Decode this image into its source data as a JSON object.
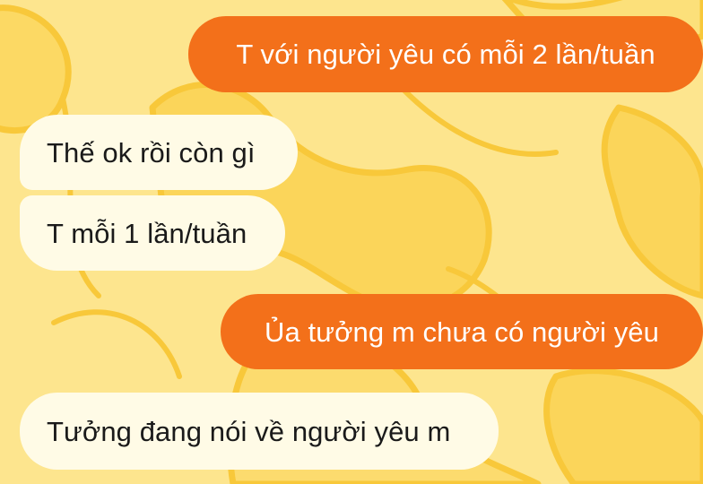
{
  "theme": {
    "background": "#fde58e",
    "outgoing_bubble_color": "#f3701a",
    "incoming_bubble_color": "#fffbe6",
    "outgoing_text_color": "#ffffff",
    "incoming_text_color": "#1a1a1a"
  },
  "messages": [
    {
      "direction": "outgoing",
      "text": "T với người yêu có mỗi 2 lần/tuần"
    },
    {
      "direction": "incoming",
      "text": "Thế ok rồi còn gì"
    },
    {
      "direction": "incoming",
      "text": "T mỗi 1 lần/tuần"
    },
    {
      "direction": "outgoing",
      "text": "Ủa tưởng m chưa có người yêu"
    },
    {
      "direction": "incoming",
      "text": "Tưởng đang nói về người yêu m"
    }
  ]
}
